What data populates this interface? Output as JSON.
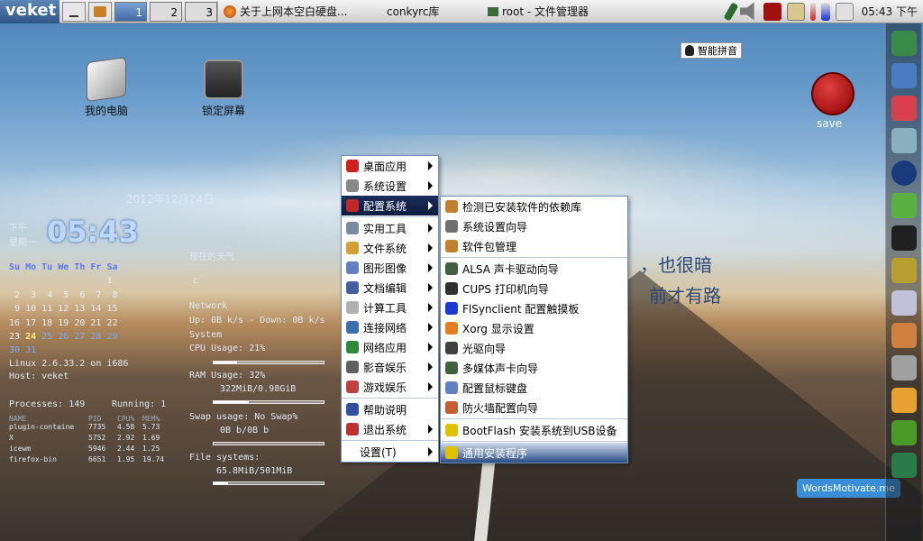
{
  "taskbar": {
    "logo": "veket",
    "workspaces": [
      "1",
      "2",
      "3"
    ],
    "tasks": [
      "关于上网本空白硬盘...",
      "conkyrc库",
      "root - 文件管理器"
    ],
    "clock": "05:43 下午"
  },
  "desktop_icons": [
    {
      "label": "我的电脑"
    },
    {
      "label": "锁定屏幕"
    }
  ],
  "conky": {
    "date": "2012年12月24日",
    "ampm": "下午",
    "weekday": "星期一",
    "time": "05:43",
    "weather_label": "现在的天气",
    "weather_unit": "c",
    "network": "Network",
    "net_rates": "Up: 0B  k/s - Down: 0B  k/s",
    "system": "System",
    "cpu": "CPU Usage: 21%",
    "cpu_frac": 0.21,
    "ram": "RAM Usage: 32%",
    "ram_detail": "322MiB/0.98GiB",
    "ram_frac": 0.32,
    "swap": "Swap usage: No Swap%",
    "swap_detail": "0B  b/0B  b",
    "swap_frac": 0.0,
    "fs": "File systems:",
    "fs_detail": "65.8MiB/501MiB",
    "fs_frac": 0.13,
    "kernel": "Linux 2.6.33.2 on i686",
    "host": "Host:  veket",
    "processes": "Processes: 149",
    "running": "Running: 1",
    "proc_headers": [
      "NAME",
      "PID",
      "CPU%",
      "MEM%"
    ],
    "proc_rows": [
      [
        "plugin-containe",
        "7735",
        "4.58",
        "5.73"
      ],
      [
        "X",
        "5752",
        "2.92",
        "1.69"
      ],
      [
        "icewm",
        "5946",
        "2.44",
        "1.25"
      ],
      [
        "firefox-bin",
        "6651",
        "1.95",
        "19.74"
      ]
    ]
  },
  "calendar": {
    "days": [
      "Su",
      "Mo",
      "Tu",
      "We",
      "Th",
      "Fr",
      "Sa"
    ],
    "rows": [
      [
        "",
        "",
        "",
        "",
        "",
        "",
        "1"
      ],
      [
        "2",
        "3",
        "4",
        "5",
        "6",
        "7",
        "8"
      ],
      [
        "9",
        "10",
        "11",
        "12",
        "13",
        "14",
        "15"
      ],
      [
        "16",
        "17",
        "18",
        "19",
        "20",
        "21",
        "22"
      ],
      [
        "23",
        "24",
        "25",
        "26",
        "27",
        "28",
        "29"
      ],
      [
        "30",
        "31",
        "",
        "",
        "",
        "",
        ""
      ]
    ],
    "today": "24"
  },
  "main_menu": {
    "items": [
      {
        "label": "桌面应用",
        "icon": "x-icon",
        "color": "#d02020",
        "sub": true
      },
      {
        "label": "系统设置",
        "icon": "bottle-icon",
        "color": "#888888",
        "sub": true
      },
      {
        "label": "配置系统",
        "icon": "wand-icon",
        "color": "#c02828",
        "sub": true,
        "selected": true
      },
      {
        "label": "实用工具",
        "icon": "tools-icon",
        "color": "#7a8aa0",
        "sub": true
      },
      {
        "label": "文件系统",
        "icon": "folder-icon",
        "color": "#d0a030",
        "sub": true
      },
      {
        "label": "图形图像",
        "icon": "image-icon",
        "color": "#6080c0",
        "sub": true
      },
      {
        "label": "文档编辑",
        "icon": "document-icon",
        "color": "#4060a0",
        "sub": true
      },
      {
        "label": "计算工具",
        "icon": "calculator-icon",
        "color": "#b0b0b0",
        "sub": true
      },
      {
        "label": "连接网络",
        "icon": "network-icon",
        "color": "#3a70b0",
        "sub": true
      },
      {
        "label": "网络应用",
        "icon": "globe-icon",
        "color": "#2a8a3a",
        "sub": true
      },
      {
        "label": "影音娱乐",
        "icon": "media-icon",
        "color": "#606060",
        "sub": true
      },
      {
        "label": "游戏娱乐",
        "icon": "joystick-icon",
        "color": "#c04040",
        "sub": true
      },
      {
        "label": "帮助说明",
        "icon": "help-icon",
        "color": "#3050a0",
        "sub": false
      },
      {
        "label": "退出系统",
        "icon": "exit-icon",
        "color": "#c03030",
        "sub": true
      },
      {
        "label": "设置(T)",
        "icon": "",
        "color": "",
        "sub": true
      }
    ]
  },
  "sub_menu": {
    "items": [
      {
        "label": "检测已安装软件的依赖库",
        "icon": "package-icon",
        "color": "#c08030"
      },
      {
        "label": "系统设置向导",
        "icon": "gear-icon",
        "color": "#707070"
      },
      {
        "label": "软件包管理",
        "icon": "package-icon",
        "color": "#c08030"
      },
      {
        "label": "ALSA 声卡驱动向导",
        "icon": "speaker-icon",
        "color": "#406040"
      },
      {
        "label": "CUPS 打印机向导",
        "icon": "printer-icon",
        "color": "#303030"
      },
      {
        "label": "FlSynclient 配置触摸板",
        "icon": "touchpad-icon",
        "color": "#1a3ad0"
      },
      {
        "label": "Xorg 显示设置",
        "icon": "display-icon",
        "color": "#e08020"
      },
      {
        "label": "光驱向导",
        "icon": "disc-icon",
        "color": "#404040"
      },
      {
        "label": "多媒体声卡向导",
        "icon": "speaker-icon",
        "color": "#406040"
      },
      {
        "label": "配置鼠标键盘",
        "icon": "keyboard-icon",
        "color": "#6080c0"
      },
      {
        "label": "防火墙配置向导",
        "icon": "firewall-icon",
        "color": "#c06030"
      },
      {
        "label": "BootFlash 安装系统到USB设备",
        "icon": "lightning-icon",
        "color": "#e0c000"
      },
      {
        "label": "通用安装程序",
        "icon": "lightning-icon",
        "color": "#e0c000",
        "selected": true
      }
    ]
  },
  "ime": "智能拼音",
  "save_label": "save",
  "words_motivate": "WordsMotivate.me",
  "quote": [
    "，也很暗",
    "前才有路"
  ]
}
